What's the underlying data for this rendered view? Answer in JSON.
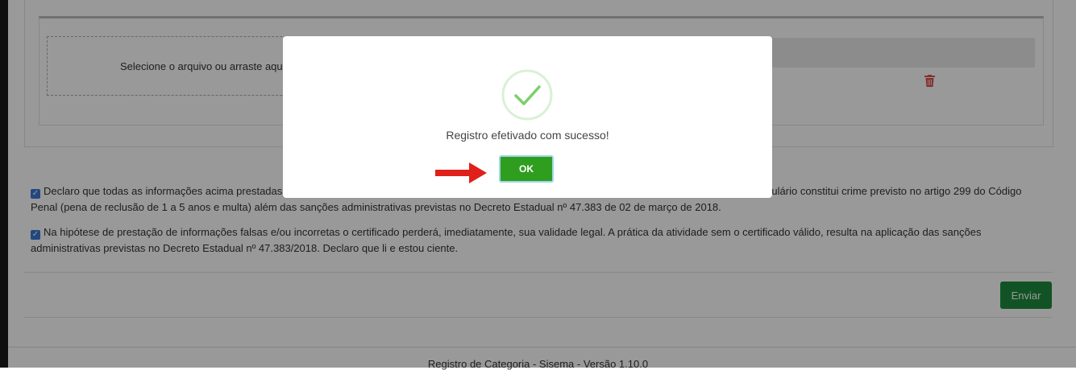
{
  "upload": {
    "dropzone_text": "Selecione o arquivo ou arraste aqu"
  },
  "declarations": [
    {
      "checked": true,
      "text_left": "Declaro que todas as informações acima prestadas",
      "text_right": "rmulário constitui crime previsto no artigo 299 do Código",
      "text_line2": "Penal (pena de reclusão de 1 a 5 anos e multa) além das sanções administrativas previstas no Decreto Estadual nº 47.383 de 02 de março de 2018."
    },
    {
      "checked": true,
      "text": "Na hipótese de prestação de informações falsas e/ou incorretas o certificado perderá, imediatamente, sua validade legal. A prática da atividade sem o certificado válido, resulta na aplicação das sanções administrativas previstas no Decreto Estadual nº 47.383/2018. Declaro que li e estou ciente."
    }
  ],
  "form": {
    "submit_label": "Enviar"
  },
  "footer": {
    "text": "Registro de Categoria - Sisema - Versão 1.10.0"
  },
  "modal": {
    "message": "Registro efetivado com sucesso!",
    "ok_label": "OK",
    "icon": "success-check-icon"
  },
  "colors": {
    "submit": "#1e8a3e",
    "ok": "#2f9e1f",
    "check": "#7ccf6a",
    "arrow": "#e0201a",
    "trash": "#d9534f",
    "checkbox": "#3b79d6"
  }
}
